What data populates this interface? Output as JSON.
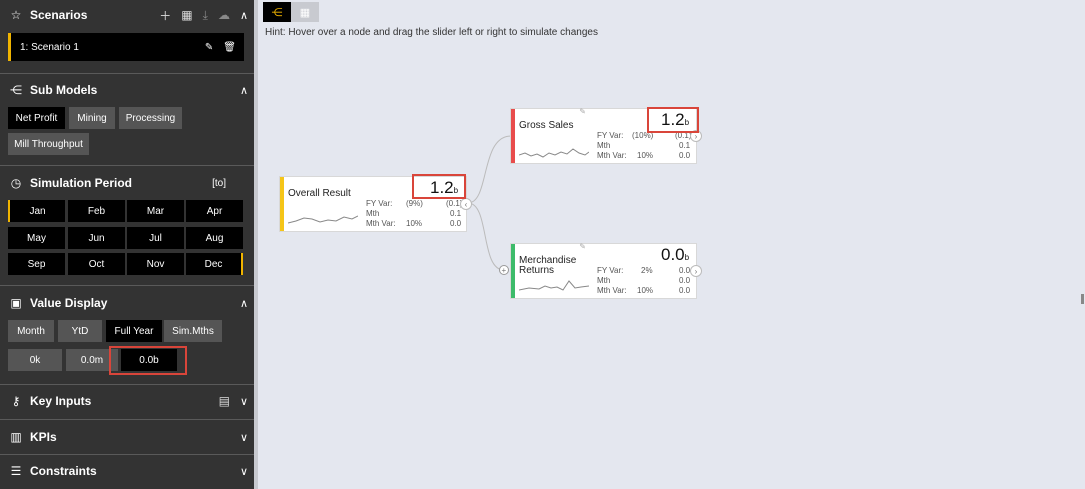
{
  "scenarios": {
    "title": "Scenarios",
    "items": [
      {
        "label": "1: Scenario 1"
      }
    ]
  },
  "sub_models": {
    "title": "Sub Models",
    "buttons": [
      "Net Profit",
      "Mining",
      "Processing",
      "Mill Throughput"
    ],
    "active": "Net Profit"
  },
  "simulation_period": {
    "title": "Simulation Period",
    "badge": "[to]",
    "months": [
      "Jan",
      "Feb",
      "Mar",
      "Apr",
      "May",
      "Jun",
      "Jul",
      "Aug",
      "Sep",
      "Oct",
      "Nov",
      "Dec"
    ]
  },
  "value_display": {
    "title": "Value Display",
    "periods": [
      "Month",
      "YtD",
      "Full Year",
      "Sim.Mths"
    ],
    "active_period": "Full Year",
    "units": [
      "0k",
      "0.0m",
      "0.0b"
    ],
    "active_unit": "0.0b"
  },
  "key_inputs": {
    "title": "Key Inputs"
  },
  "kpis": {
    "title": "KPIs"
  },
  "constraints": {
    "title": "Constraints"
  },
  "hint": "Hint: Hover over a node and drag the slider left or right to simulate changes",
  "colors": {
    "accent": "#f0b400",
    "highlight": "#d9453a",
    "sidebar_bg": "#333333",
    "canvas_bg": "#e4e7ef"
  },
  "nodes": [
    {
      "id": "overall",
      "name": "Overall Result",
      "value": "1.2",
      "unit": "b",
      "color": "#f5c518",
      "labels": [
        "FY Var:",
        "Mth",
        "Mth Var:"
      ],
      "col1": [
        "(9%)",
        "",
        "10%"
      ],
      "col2": [
        "(0.1)",
        "0.1",
        "0.0"
      ]
    },
    {
      "id": "gross",
      "name": "Gross Sales",
      "value": "1.2",
      "unit": "b",
      "color": "#e84c4c",
      "labels": [
        "FY Var:",
        "Mth",
        "Mth Var:"
      ],
      "col1": [
        "(10%)",
        "",
        "10%"
      ],
      "col2": [
        "(0.1)",
        "0.1",
        "0.0"
      ]
    },
    {
      "id": "returns",
      "name": "Merchandise Returns",
      "name_line1": "Merchandise",
      "name_line2": "Returns",
      "value": "0.0",
      "unit": "b",
      "color": "#3dbb6a",
      "labels": [
        "FY Var:",
        "Mth",
        "Mth Var:"
      ],
      "col1": [
        "2%",
        "",
        "10%"
      ],
      "col2": [
        "0.0",
        "0.0",
        "0.0"
      ]
    }
  ]
}
